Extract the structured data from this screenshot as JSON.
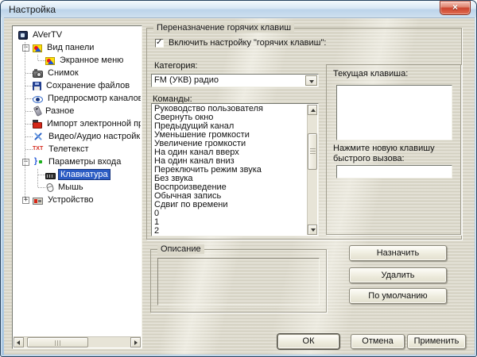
{
  "window": {
    "title": "Настройка"
  },
  "icons": {
    "close": "×"
  },
  "tree": {
    "items": [
      {
        "label": "AVerTV",
        "icon": "avertv-icon",
        "level": 0,
        "expander": "none"
      },
      {
        "label": "Вид панели",
        "icon": "panel-icon",
        "level": 1,
        "expander": "minus"
      },
      {
        "label": "Экранное меню",
        "icon": "panel-icon",
        "level": 2,
        "expander": "none"
      },
      {
        "label": "Снимок",
        "icon": "camera-icon",
        "level": 1,
        "expander": "none"
      },
      {
        "label": "Сохранение файлов",
        "icon": "save-icon",
        "level": 1,
        "expander": "none"
      },
      {
        "label": "Предпросмотр каналов",
        "icon": "eye-icon",
        "level": 1,
        "expander": "none"
      },
      {
        "label": "Разное",
        "icon": "remote-icon",
        "level": 1,
        "expander": "none"
      },
      {
        "label": "Импорт электронной прог",
        "icon": "import-icon",
        "level": 1,
        "expander": "none"
      },
      {
        "label": "Видео/Аудио настройки",
        "icon": "tools-icon",
        "level": 1,
        "expander": "none"
      },
      {
        "label": "Телетекст",
        "icon": "txt-icon",
        "level": 1,
        "expander": "none"
      },
      {
        "label": "Параметры входа",
        "icon": "input-icon",
        "level": 1,
        "expander": "minus"
      },
      {
        "label": "Клавиатура",
        "icon": "keyboard-icon",
        "level": 2,
        "expander": "none",
        "selected": true
      },
      {
        "label": "Мышь",
        "icon": "mouse-icon",
        "level": 2,
        "expander": "none"
      },
      {
        "label": "Устройство",
        "icon": "device-icon",
        "level": 1,
        "expander": "plus"
      }
    ]
  },
  "hotkeys": {
    "group_title": "Переназначение горячих клавиш",
    "enable_checkbox": {
      "label": "Включить настройку \"горячих клавиш\":",
      "checked": true
    },
    "category": {
      "label": "Категория:",
      "value": "FM (УКВ) радио"
    },
    "commands": {
      "label": "Команды:",
      "items": [
        "Руководство пользователя",
        "Свернуть окно",
        "Предыдущий канал",
        "Уменьшение громкости",
        "Увеличение громкости",
        "На один канал вверх",
        "На один канал вниз",
        "Переключить режим звука",
        "Без звука",
        "Воспроизведение",
        "Обычная запись",
        "Сдвиг по времени",
        "0",
        "1",
        "2"
      ]
    },
    "current_key": {
      "label": "Текущая клавиша:",
      "value": ""
    },
    "new_key": {
      "label": "Нажмите новую клавишу быстрого вызова:",
      "value": ""
    },
    "buttons": {
      "assign": "Назначить",
      "remove": "Удалить",
      "default": "По умолчанию"
    }
  },
  "description": {
    "group_title": "Описание",
    "text": ""
  },
  "footer": {
    "ok": "ОК",
    "cancel": "Отмена",
    "apply": "Применить"
  },
  "colors": {
    "selection": "#2b5cc4",
    "titlebar": "#cfe0ef",
    "dialog_bg": "#dcd9cb",
    "close_button": "#cc4630"
  }
}
